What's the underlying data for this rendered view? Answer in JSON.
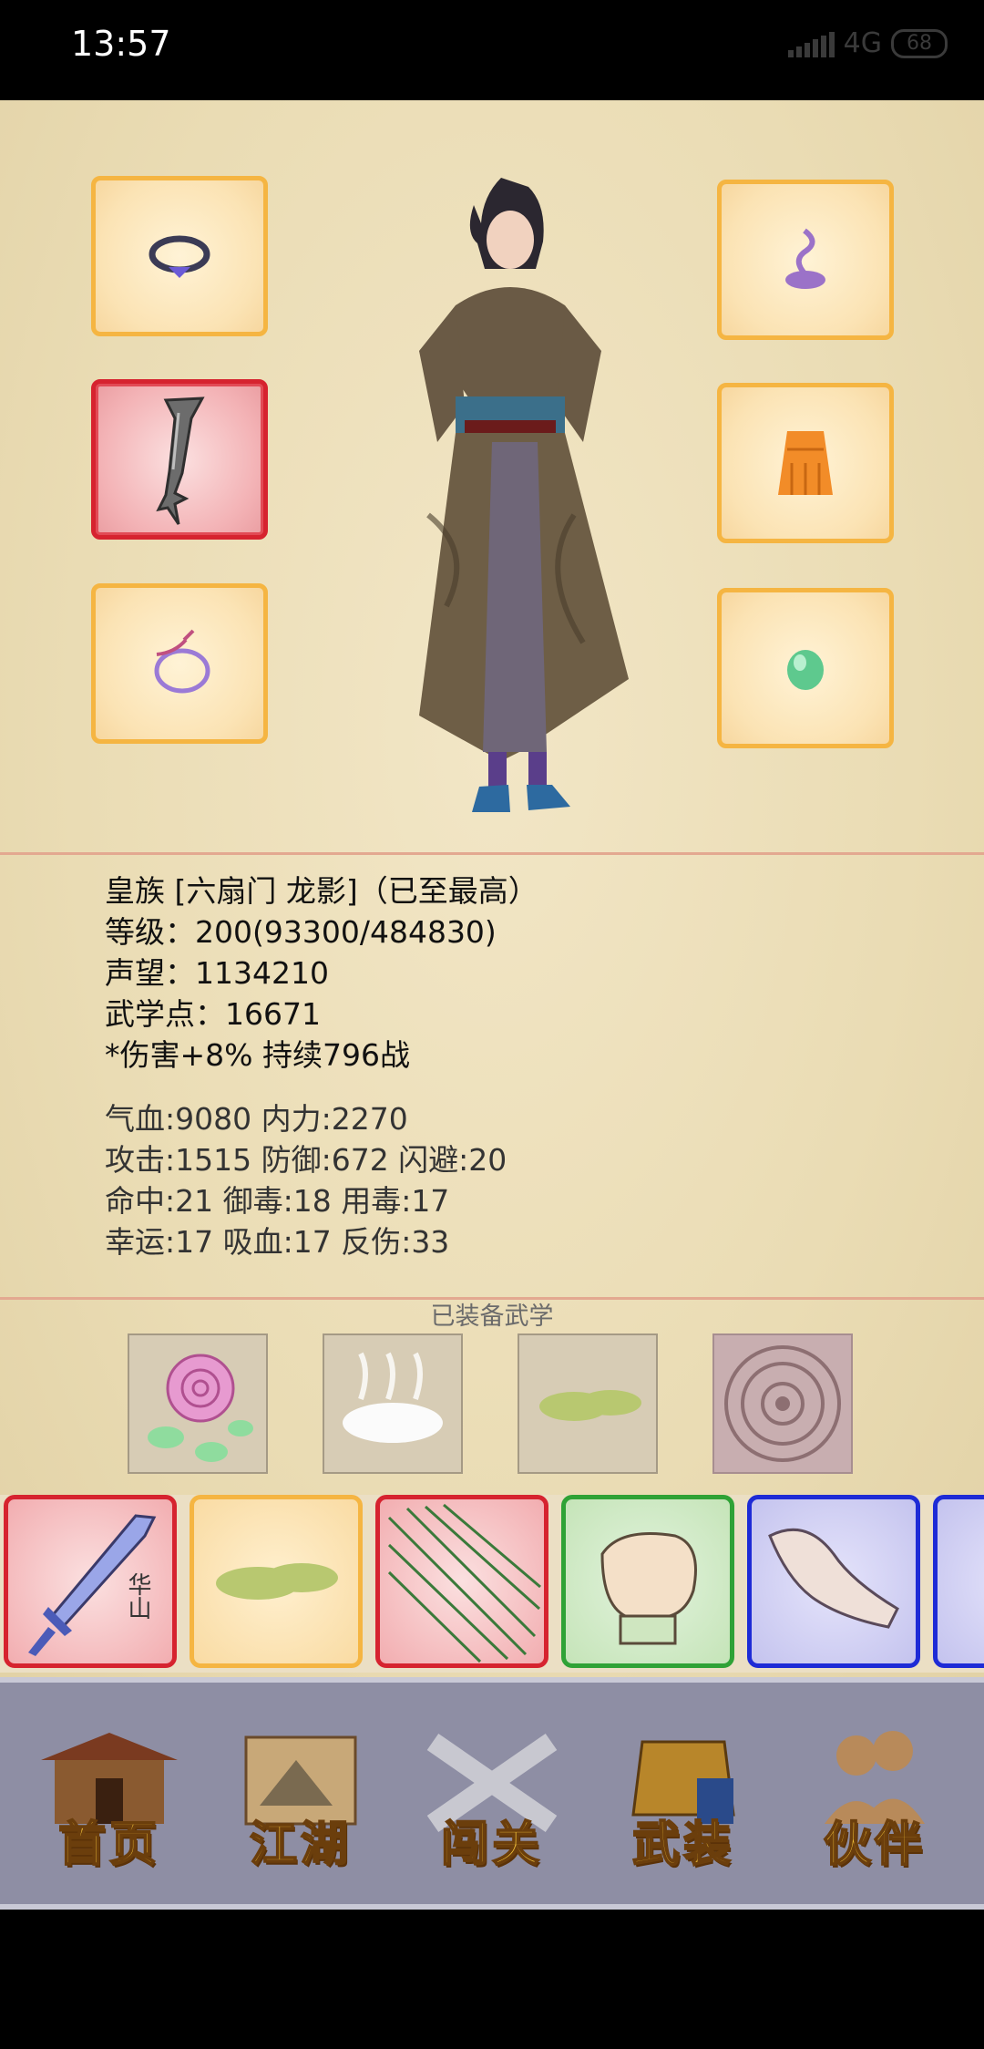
{
  "status_bar": {
    "time": "13:57",
    "network": "4G",
    "battery": "68"
  },
  "character": {
    "title": "皇族 [六扇门 龙影]（已至最高）",
    "level": "等级：200(93300/484830)",
    "prestige": "声望：1134210",
    "martial_points": "武学点：16671",
    "buff": "*伤害+8% 持续796战"
  },
  "stats": {
    "line1": "气血:9080  内力:2270",
    "line2": "攻击:1515  防御:672  闪避:20",
    "line3": "命中:21  御毒:18  用毒:17",
    "line4": "幸运:17  吸血:17  反伤:33"
  },
  "equipped_skills": {
    "title": "已装备武学",
    "icons": [
      "rose-icon",
      "mist-icon",
      "green-cloud-icon",
      "stone-disc-icon"
    ]
  },
  "equipment_slots": [
    {
      "icon": "ring-icon",
      "rarity": "orange"
    },
    {
      "icon": "blade-icon",
      "rarity": "red"
    },
    {
      "icon": "cord-icon",
      "rarity": "orange"
    },
    {
      "icon": "incense-icon",
      "rarity": "orange"
    },
    {
      "icon": "robe-icon",
      "rarity": "orange"
    },
    {
      "icon": "jade-icon",
      "rarity": "orange"
    }
  ],
  "martial_cards": [
    {
      "icon": "sword-icon",
      "label": "华山",
      "rarity": "red"
    },
    {
      "icon": "green-cloud-icon",
      "rarity": "orange"
    },
    {
      "icon": "needles-icon",
      "rarity": "red"
    },
    {
      "icon": "fist-icon",
      "rarity": "green"
    },
    {
      "icon": "palm-icon",
      "rarity": "blue"
    },
    {
      "icon": "partial-card-icon",
      "rarity": "blue"
    }
  ],
  "nav": {
    "home": "首页",
    "jianghu": "江湖",
    "challenge": "闯关",
    "equipment": "武装",
    "partners": "伙伴"
  },
  "colors": {
    "rarity_red": "#d6232f",
    "rarity_orange": "#f5b542",
    "rarity_green": "#2fa236",
    "rarity_blue": "#1e2bd6",
    "nav_text": "#f2c23a"
  }
}
